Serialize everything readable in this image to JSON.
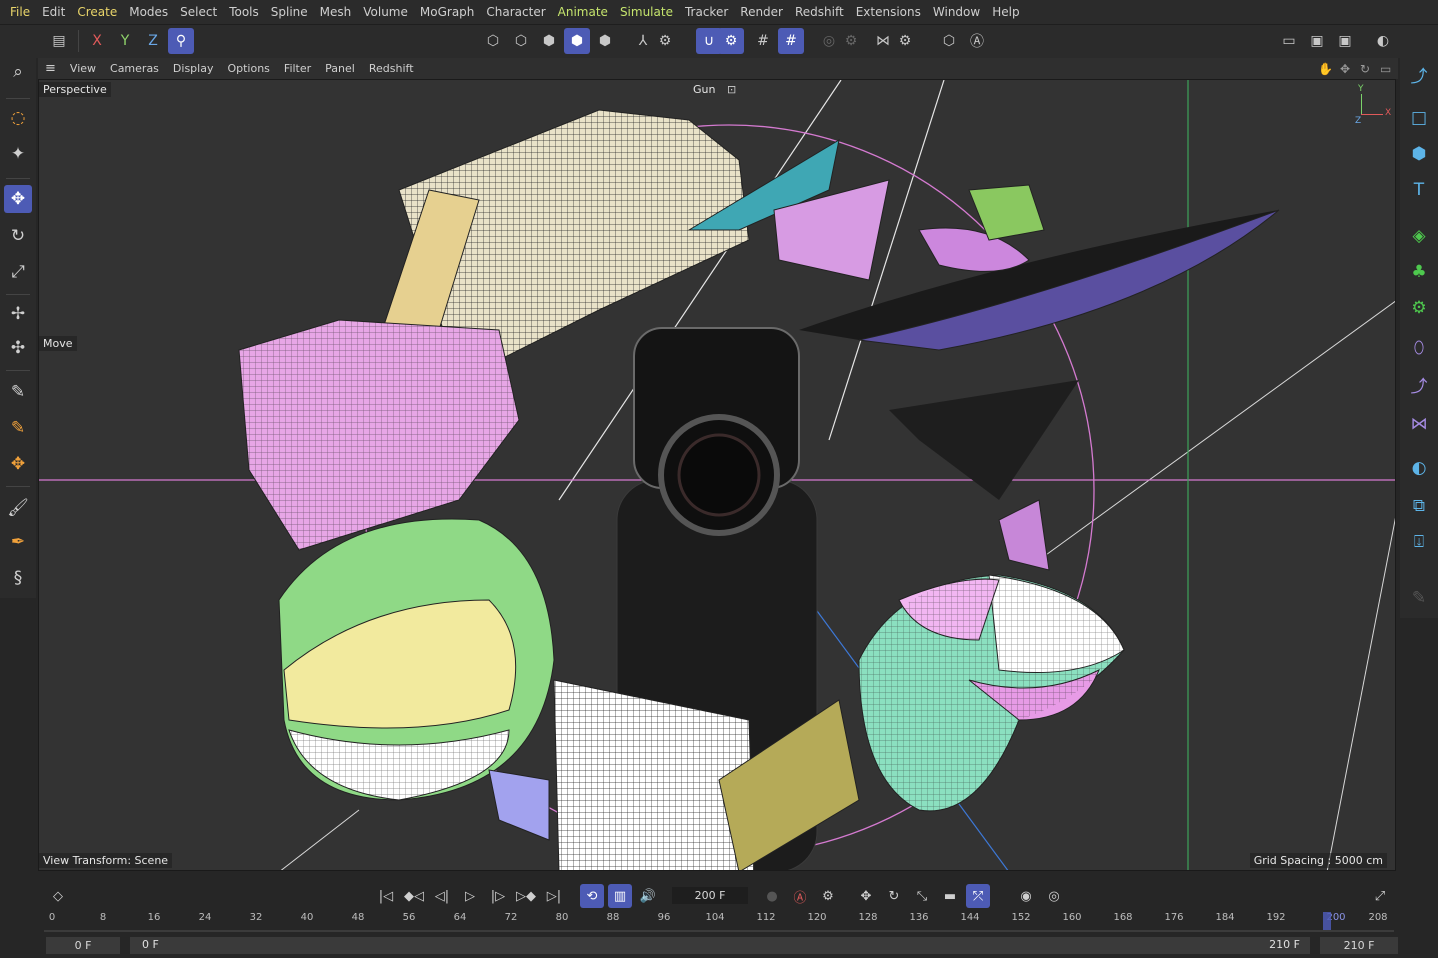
{
  "menu": [
    "File",
    "Edit",
    "Create",
    "Modes",
    "Select",
    "Tools",
    "Spline",
    "Mesh",
    "Volume",
    "MoGraph",
    "Character",
    "Animate",
    "Simulate",
    "Tracker",
    "Render",
    "Redshift",
    "Extensions",
    "Window",
    "Help"
  ],
  "toolbar": {
    "axis_x": "X",
    "axis_y": "Y",
    "axis_z": "Z"
  },
  "viewport_menu": [
    "View",
    "Cameras",
    "Display",
    "Options",
    "Filter",
    "Panel",
    "Redshift"
  ],
  "viewport": {
    "camera_label": "Perspective",
    "active_camera": "Gun",
    "tool_label": "Move",
    "view_transform": "View Transform: Scene",
    "grid_spacing": "Grid Spacing : 5000 cm",
    "gizmo_axes": {
      "y": "Y",
      "x": "X",
      "z": "Z"
    },
    "colors": {
      "bg": "#333333",
      "horizon": "#d47ad0",
      "green_axis": "#3ea35a",
      "blue_axis": "#3d78d6"
    }
  },
  "timeline": {
    "current_frame": "200 F",
    "ticks": [
      "0",
      "8",
      "16",
      "24",
      "32",
      "40",
      "48",
      "56",
      "64",
      "72",
      "80",
      "88",
      "96",
      "104",
      "112",
      "120",
      "128",
      "136",
      "144",
      "152",
      "160",
      "168",
      "176",
      "184",
      "192",
      "200",
      "208"
    ],
    "playhead_frame": 200,
    "max_frame": 210,
    "start_min": "0 F",
    "start": "0 F",
    "end": "210 F",
    "end_max": "210 F"
  },
  "accent": "#4d5bb5"
}
